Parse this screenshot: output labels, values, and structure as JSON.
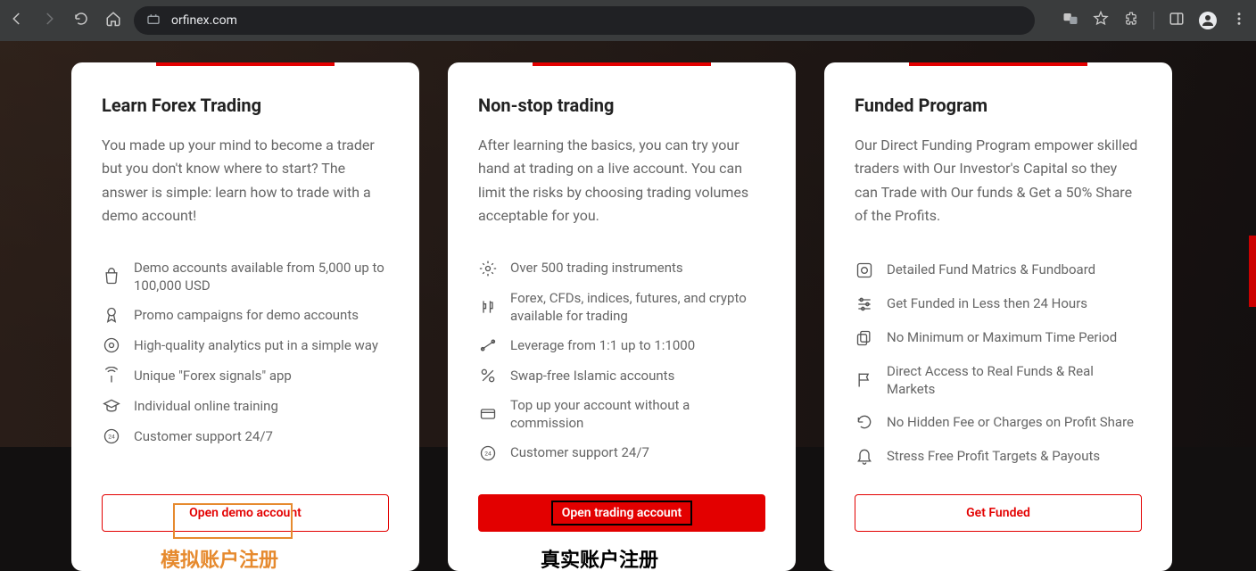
{
  "browser": {
    "url": "orfinex.com"
  },
  "cards": [
    {
      "title": "Learn Forex Trading",
      "desc": "You made up your mind to become a trader but you don't know where to start? The answer is simple: learn how to trade with a demo account!",
      "features": [
        "Demo accounts available from 5,000 up to 100,000 USD",
        "Promo campaigns for demo accounts",
        "High-quality analytics put in a simple way",
        "Unique \"Forex signals\" app",
        "Individual online training",
        "Customer support 24/7"
      ],
      "button": "Open demo account",
      "annotation": "模拟账户注册"
    },
    {
      "title": "Non-stop trading",
      "desc": "After learning the basics, you can try your hand at trading on a live account. You can limit the risks by choosing trading volumes acceptable for you.",
      "features": [
        "Over 500 trading instruments",
        "Forex, CFDs, indices, futures, and crypto available for trading",
        "Leverage from 1:1 up to 1:1000",
        "Swap-free Islamic accounts",
        "Top up your account without a commission",
        "Customer support 24/7"
      ],
      "button": "Open trading account",
      "annotation": "真实账户注册"
    },
    {
      "title": "Funded Program",
      "desc": "Our Direct Funding Program empower skilled traders with Our Investor's Capital so they can Trade with Our funds & Get a 50% Share of the Profits.",
      "features": [
        "Detailed Fund Matrics & Fundboard",
        "Get Funded in Less then 24 Hours",
        "No Minimum or Maximum Time Period",
        "Direct Access to Real Funds & Real Markets",
        "No Hidden Fee or Charges on Profit Share",
        "Stress Free Profit Targets & Payouts"
      ],
      "button": "Get Funded"
    }
  ]
}
